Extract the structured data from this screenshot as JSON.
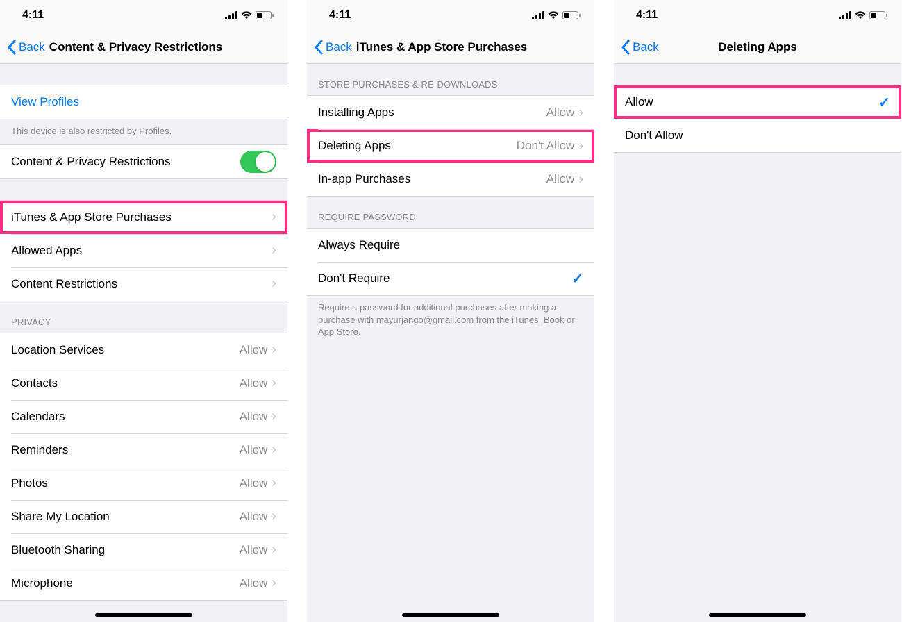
{
  "status": {
    "time": "4:11"
  },
  "screen1": {
    "back": "Back",
    "title": "Content & Privacy Restrictions",
    "viewProfiles": "View Profiles",
    "profilesNote": "This device is also restricted by Profiles.",
    "toggleRow": "Content & Privacy Restrictions",
    "rows": [
      {
        "label": "iTunes & App Store Purchases"
      },
      {
        "label": "Allowed Apps"
      },
      {
        "label": "Content Restrictions"
      }
    ],
    "privacyHeader": "PRIVACY",
    "privacy": [
      {
        "label": "Location Services",
        "value": "Allow"
      },
      {
        "label": "Contacts",
        "value": "Allow"
      },
      {
        "label": "Calendars",
        "value": "Allow"
      },
      {
        "label": "Reminders",
        "value": "Allow"
      },
      {
        "label": "Photos",
        "value": "Allow"
      },
      {
        "label": "Share My Location",
        "value": "Allow"
      },
      {
        "label": "Bluetooth Sharing",
        "value": "Allow"
      },
      {
        "label": "Microphone",
        "value": "Allow"
      }
    ]
  },
  "screen2": {
    "back": "Back",
    "title": "iTunes & App Store Purchases",
    "storeHeader": "STORE PURCHASES & RE-DOWNLOADS",
    "store": [
      {
        "label": "Installing Apps",
        "value": "Allow"
      },
      {
        "label": "Deleting Apps",
        "value": "Don't Allow"
      },
      {
        "label": "In-app Purchases",
        "value": "Allow"
      }
    ],
    "passwordHeader": "REQUIRE PASSWORD",
    "password": [
      {
        "label": "Always Require",
        "checked": false
      },
      {
        "label": "Don't Require",
        "checked": true
      }
    ],
    "passwordFooter": "Require a password for additional purchases after making a purchase with mayurjango@gmail.com from the iTunes, Book or App Store."
  },
  "screen3": {
    "back": "Back",
    "title": "Deleting Apps",
    "options": [
      {
        "label": "Allow",
        "checked": true
      },
      {
        "label": "Don't Allow",
        "checked": false
      }
    ]
  }
}
